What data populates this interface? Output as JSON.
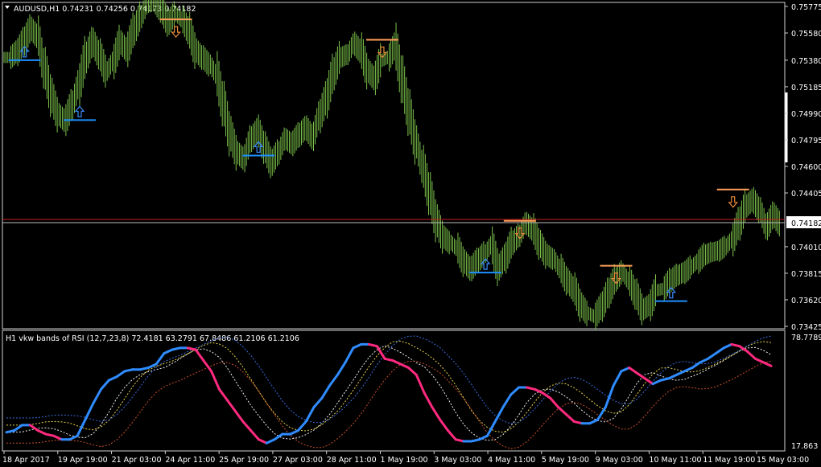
{
  "main": {
    "header": "AUDUSD,H1  0.74231 0.74256 0.74173 0.74182",
    "current_price": "0.74182",
    "y_ticks": [
      "0.75775",
      "0.75580",
      "0.75380",
      "0.75185",
      "0.74990",
      "0.74795",
      "0.74600",
      "0.74405",
      "0.74010",
      "0.73815",
      "0.73620",
      "0.73425"
    ]
  },
  "indicator": {
    "header": "H1 vkw bands of RSI (12,7,23,8) 72.4181 63.2791 67.8486 61.2106 61.2106",
    "y_top": "78.7789",
    "y_bottom": "17.863"
  },
  "x_axis": {
    "labels": [
      "18 Apr 2017",
      "19 Apr 19:00",
      "21 Apr 03:00",
      "24 Apr 11:00",
      "25 Apr 19:00",
      "27 Apr 03:00",
      "28 Apr 11:00",
      "1 May 19:00",
      "3 May 03:00",
      "4 May 11:00",
      "5 May 19:00",
      "9 May 03:00",
      "10 May 11:00",
      "11 May 19:00",
      "15 May 03:00"
    ]
  },
  "colors": {
    "background": "#000000",
    "candles": "#7cc24a",
    "support": "#1e90ff",
    "resistance": "#ff9f5a",
    "up_arrow": "#3a8eff",
    "down_arrow": "#e88a3a",
    "price_line": "#c81e1e",
    "rsi_up": "#2f8cff",
    "rsi_down": "#ff2a7f"
  },
  "chart_data": {
    "type": "line",
    "series": [
      {
        "values": [
          0.754,
          0.7544,
          0.7552,
          0.7561,
          0.7556,
          0.7532,
          0.7512,
          0.7498,
          0.7494,
          0.7505,
          0.752,
          0.754,
          0.7551,
          0.7542,
          0.753,
          0.7537,
          0.7551,
          0.7546,
          0.756,
          0.757,
          0.758,
          0.7581,
          0.7575,
          0.7566,
          0.7572,
          0.7568,
          0.756,
          0.7545,
          0.754,
          0.7535,
          0.7528,
          0.7506,
          0.7484,
          0.747,
          0.7466,
          0.748,
          0.7486,
          0.7474,
          0.7463,
          0.747,
          0.748,
          0.7477,
          0.7483,
          0.7488,
          0.7482,
          0.7497,
          0.751,
          0.7528,
          0.754,
          0.7542,
          0.755,
          0.7545,
          0.753,
          0.7525,
          0.7538,
          0.754,
          0.7548,
          0.7524,
          0.75,
          0.7478,
          0.746,
          0.744,
          0.742,
          0.7408,
          0.7404,
          0.74,
          0.739,
          0.7385,
          0.7391,
          0.7396,
          0.7402,
          0.7386,
          0.7393,
          0.7404,
          0.7409,
          0.7418,
          0.7414,
          0.7403,
          0.7395,
          0.7392,
          0.7385,
          0.7376,
          0.737,
          0.7358,
          0.7352,
          0.735,
          0.7357,
          0.7367,
          0.7377,
          0.7382,
          0.7376,
          0.7366,
          0.7355,
          0.7358,
          0.7369,
          0.737,
          0.7376,
          0.738,
          0.7382,
          0.7386,
          0.739,
          0.7395,
          0.7397,
          0.7398,
          0.7401,
          0.7406,
          0.7418,
          0.7431,
          0.7435,
          0.7428,
          0.7416,
          0.7424,
          0.7418
        ]
      }
    ],
    "support_lines": [
      {
        "value": 0.7538
      },
      {
        "value": 0.7494
      },
      {
        "value": 0.7468
      },
      {
        "value": 0.7382
      },
      {
        "value": 0.7361
      }
    ],
    "resistance_lines": [
      {
        "value": 0.7568
      },
      {
        "value": 0.7553
      },
      {
        "value": 0.742
      },
      {
        "value": 0.7387
      },
      {
        "value": 0.7443
      }
    ],
    "current_price": 0.74182,
    "ylim": [
      0.73425,
      0.75775
    ]
  },
  "rsi_data": {
    "ylim": [
      17.863,
      78.7789
    ],
    "values": [
      26,
      27,
      30,
      30,
      27,
      25,
      24,
      22,
      22,
      24,
      33,
      42,
      50,
      55,
      57,
      60,
      61,
      61,
      62,
      64,
      70,
      72,
      73,
      73,
      72,
      66,
      60,
      50,
      44,
      38,
      32,
      27,
      22,
      20,
      22,
      25,
      25,
      27,
      32,
      40,
      45,
      52,
      58,
      65,
      73,
      75,
      75,
      74,
      67,
      66,
      64,
      62,
      58,
      48,
      40,
      33,
      27,
      22,
      21,
      21,
      22,
      24,
      32,
      40,
      47,
      51,
      51,
      50,
      48,
      45,
      40,
      36,
      32,
      31,
      31,
      33,
      40,
      52,
      60,
      62,
      59,
      56,
      53,
      55,
      56,
      58,
      60,
      62,
      65,
      67,
      70,
      73,
      75,
      74,
      71,
      67,
      65,
      63
    ]
  }
}
